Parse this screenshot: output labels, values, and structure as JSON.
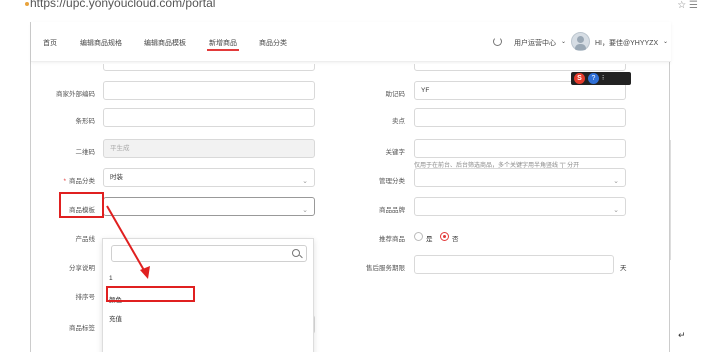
{
  "browser": {
    "url": "https://upc.yonyoucloud.com/portal",
    "icons": "☆ ☰"
  },
  "nav": {
    "items": [
      {
        "label": "首页"
      },
      {
        "label": "编辑商品规格"
      },
      {
        "label": "编辑商品模板"
      },
      {
        "label": "新增商品",
        "active": true
      },
      {
        "label": "商品分类"
      }
    ],
    "user_center": "用户运营中心",
    "greeting": "HI，要佳@YHYYZX"
  },
  "ime": {
    "s": "S",
    "q": "?",
    "d": "⁝"
  },
  "form": {
    "left": {
      "merchant_code": {
        "label": "商家外部编码",
        "value": ""
      },
      "barcode": {
        "label": "条形码",
        "value": ""
      },
      "qrcode": {
        "label": "二维码",
        "placeholder": "平生成"
      },
      "category": {
        "label": "商品分类",
        "value": "时装",
        "required_mark": "*"
      },
      "template": {
        "label": "商品模板",
        "value": ""
      },
      "product_line": {
        "label": "产品线"
      },
      "share_desc": {
        "label": "分享说明"
      },
      "sort_no": {
        "label": "排序号"
      },
      "tags": {
        "label": "商品标签",
        "value": ""
      }
    },
    "right": {
      "mnemonic": {
        "label": "助记码",
        "value": "YF"
      },
      "selling_point": {
        "label": "卖点",
        "value": ""
      },
      "keywords": {
        "label": "关键字",
        "value": "",
        "hint": "仅用于在前台、后台筛选商品，多个关键字用半角竖线 \"|\" 分开"
      },
      "mgmt_category": {
        "label": "管理分类",
        "value": ""
      },
      "brand": {
        "label": "商品品牌",
        "value": ""
      },
      "recommend": {
        "label": "推荐商品",
        "yes": "是",
        "no": "否",
        "selected": "no"
      },
      "after_sale": {
        "label": "售后服务期限",
        "value": "",
        "unit": "天"
      }
    }
  },
  "dropdown": {
    "search_placeholder": "",
    "options": [
      "1",
      "颜色",
      "充值"
    ],
    "highlighted": "颜色"
  },
  "doc": {
    "pilcrow": "↵"
  },
  "colors": {
    "accent": "#e23a3a",
    "annotation": "#e02020"
  }
}
